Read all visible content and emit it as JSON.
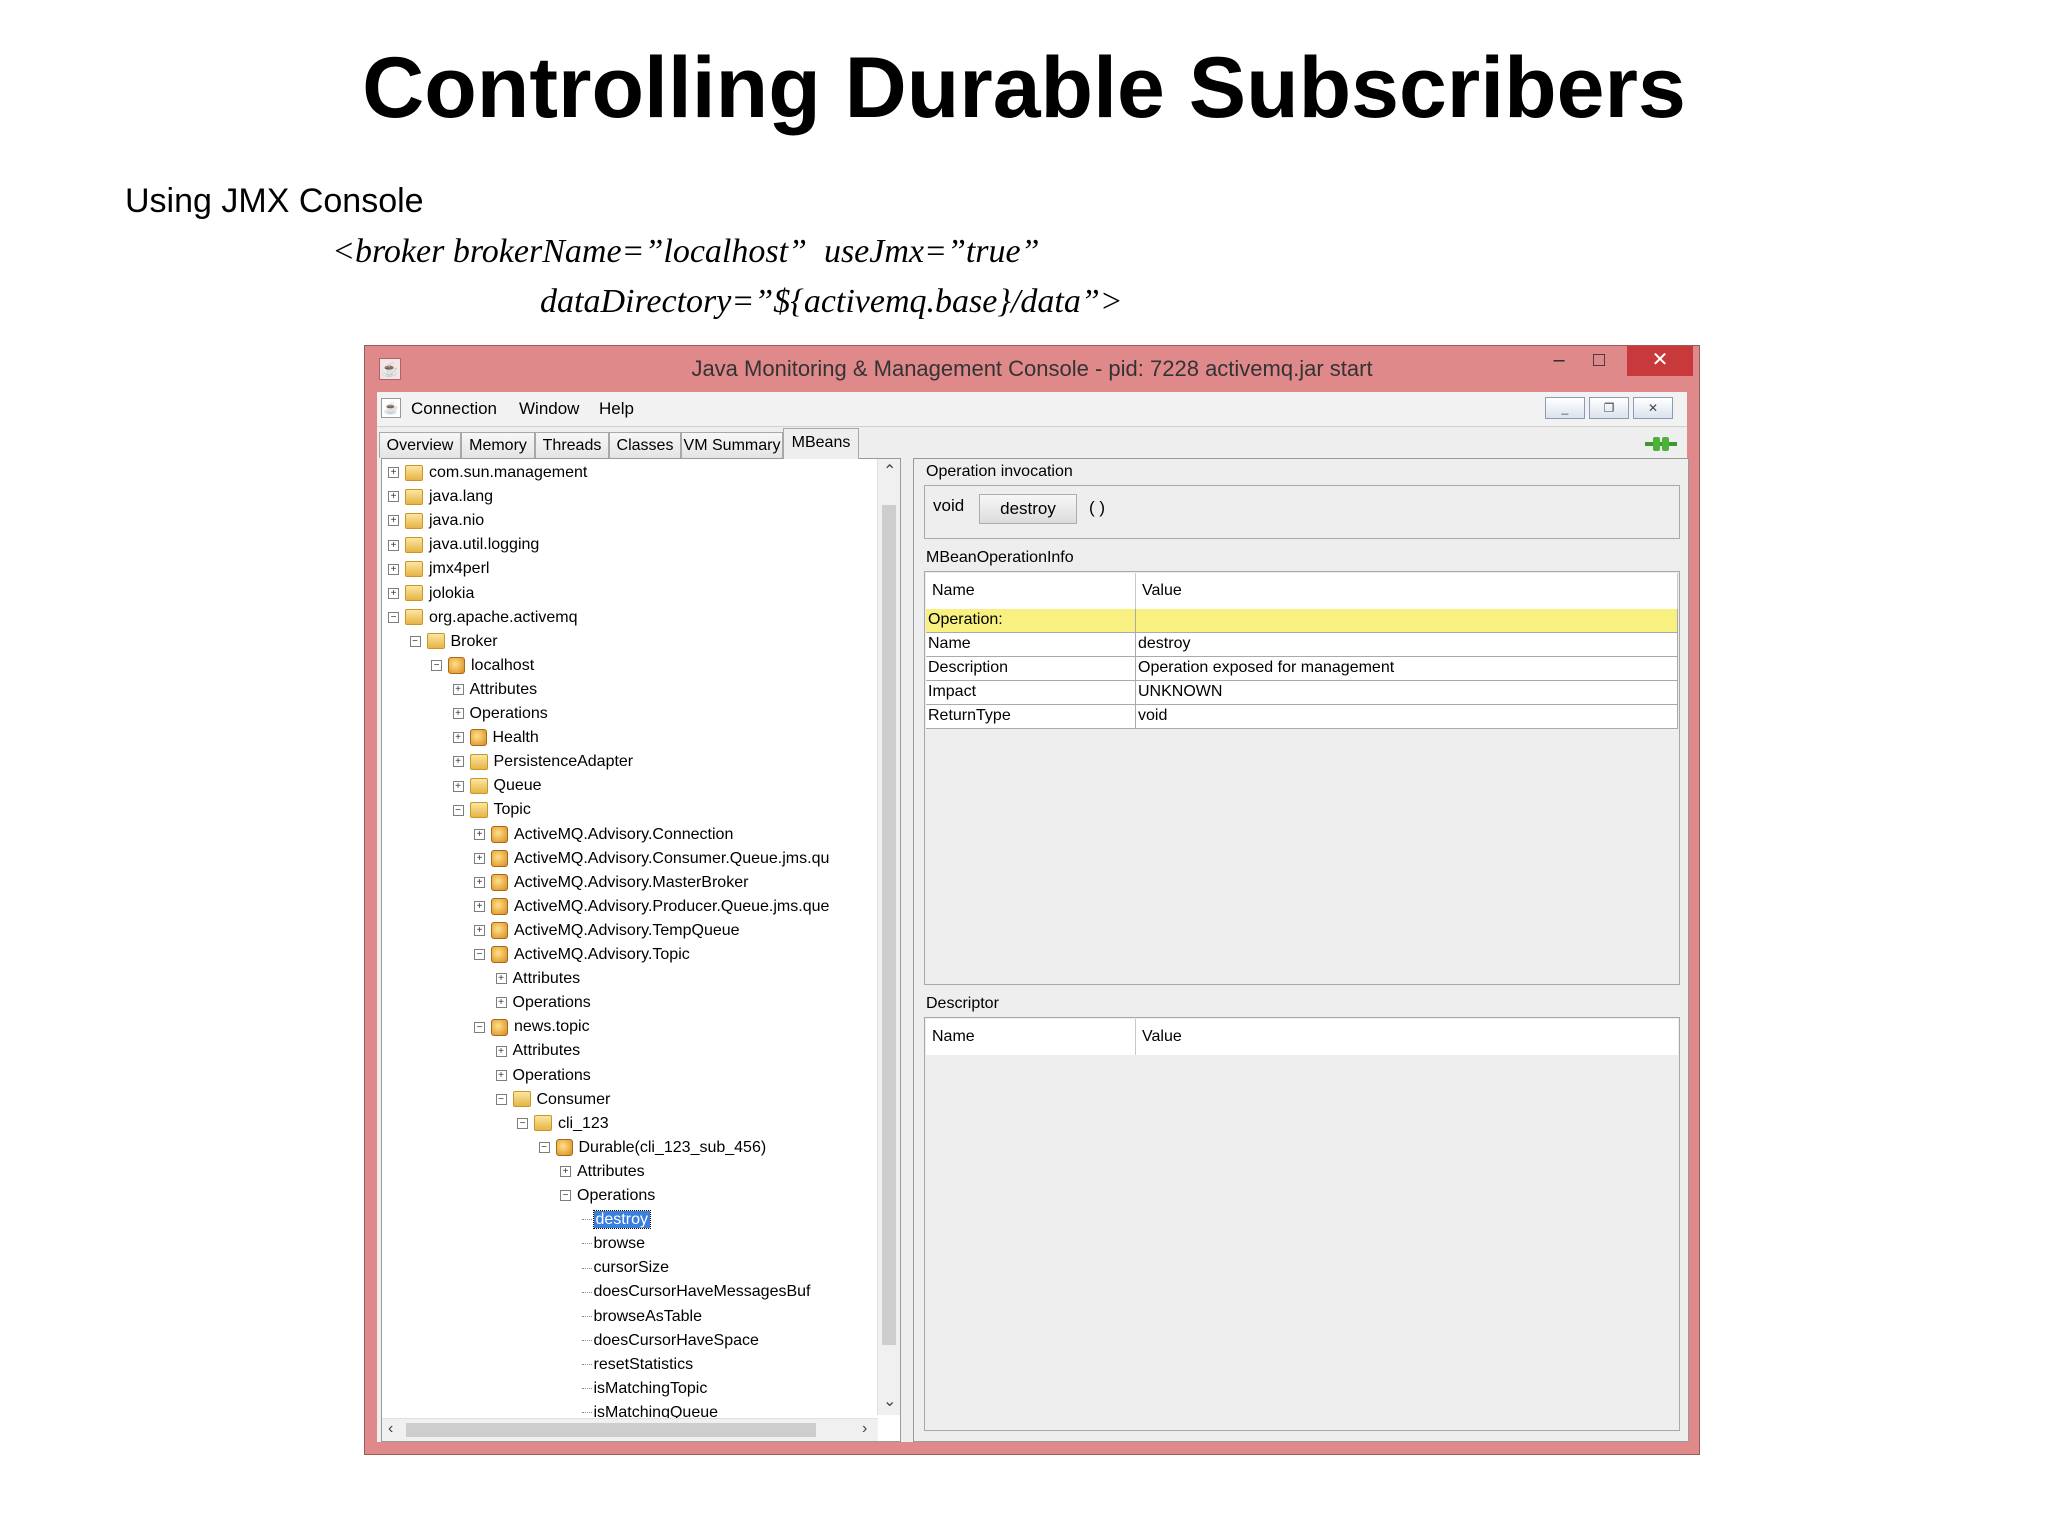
{
  "slide": {
    "title": "Controlling Durable Subscribers",
    "subtitle": "Using JMX Console",
    "code_line1": "<broker brokerName=”localhost”  useJmx=”true”",
    "code_line2": "dataDirectory=”${activemq.base}/data”>"
  },
  "window": {
    "title": "Java Monitoring & Management Console - pid: 7228 activemq.jar start",
    "controls": {
      "minimize": "–",
      "maximize": "□",
      "close": "✕"
    },
    "inner_controls": {
      "minimize": "_",
      "restore": "❐",
      "close": "✕"
    }
  },
  "menu": {
    "items": [
      "Connection",
      "Window",
      "Help"
    ]
  },
  "tabs": {
    "items": [
      "Overview",
      "Memory",
      "Threads",
      "Classes",
      "VM Summary",
      "MBeans"
    ],
    "active": "MBeans"
  },
  "tree": {
    "nodes": [
      {
        "label": "com.sun.management",
        "toggle": "+",
        "icon": "folder"
      },
      {
        "label": "java.lang",
        "toggle": "+",
        "icon": "folder"
      },
      {
        "label": "java.nio",
        "toggle": "+",
        "icon": "folder"
      },
      {
        "label": "java.util.logging",
        "toggle": "+",
        "icon": "folder"
      },
      {
        "label": "jmx4perl",
        "toggle": "+",
        "icon": "folder"
      },
      {
        "label": "jolokia",
        "toggle": "+",
        "icon": "folder"
      },
      {
        "label": "org.apache.activemq",
        "toggle": "−",
        "icon": "folder"
      },
      {
        "label": "Broker",
        "toggle": "−",
        "icon": "folder"
      },
      {
        "label": "localhost",
        "toggle": "−",
        "icon": "bean"
      },
      {
        "label": "Attributes",
        "toggle": "+",
        "icon": "none"
      },
      {
        "label": "Operations",
        "toggle": "+",
        "icon": "none"
      },
      {
        "label": "Health",
        "toggle": "+",
        "icon": "bean"
      },
      {
        "label": "PersistenceAdapter",
        "toggle": "+",
        "icon": "folder"
      },
      {
        "label": "Queue",
        "toggle": "+",
        "icon": "folder"
      },
      {
        "label": "Topic",
        "toggle": "−",
        "icon": "folder"
      },
      {
        "label": "ActiveMQ.Advisory.Connection",
        "toggle": "+",
        "icon": "bean"
      },
      {
        "label": "ActiveMQ.Advisory.Consumer.Queue.jms.qu",
        "toggle": "+",
        "icon": "bean"
      },
      {
        "label": "ActiveMQ.Advisory.MasterBroker",
        "toggle": "+",
        "icon": "bean"
      },
      {
        "label": "ActiveMQ.Advisory.Producer.Queue.jms.que",
        "toggle": "+",
        "icon": "bean"
      },
      {
        "label": "ActiveMQ.Advisory.TempQueue",
        "toggle": "+",
        "icon": "bean"
      },
      {
        "label": "ActiveMQ.Advisory.Topic",
        "toggle": "−",
        "icon": "bean"
      },
      {
        "label": "Attributes",
        "toggle": "+",
        "icon": "none"
      },
      {
        "label": "Operations",
        "toggle": "+",
        "icon": "none"
      },
      {
        "label": "news.topic",
        "toggle": "−",
        "icon": "bean"
      },
      {
        "label": "Attributes",
        "toggle": "+",
        "icon": "none"
      },
      {
        "label": "Operations",
        "toggle": "+",
        "icon": "none"
      },
      {
        "label": "Consumer",
        "toggle": "−",
        "icon": "folder"
      },
      {
        "label": "cli_123",
        "toggle": "−",
        "icon": "folder"
      },
      {
        "label": "Durable(cli_123_sub_456)",
        "toggle": "−",
        "icon": "bean"
      },
      {
        "label": "Attributes",
        "toggle": "+",
        "icon": "none"
      },
      {
        "label": "Operations",
        "toggle": "−",
        "icon": "none"
      },
      {
        "label": "destroy",
        "toggle": "",
        "icon": "leaf",
        "selected": true
      },
      {
        "label": "browse",
        "toggle": "",
        "icon": "leaf"
      },
      {
        "label": "cursorSize",
        "toggle": "",
        "icon": "leaf"
      },
      {
        "label": "doesCursorHaveMessagesBuf",
        "toggle": "",
        "icon": "leaf"
      },
      {
        "label": "browseAsTable",
        "toggle": "",
        "icon": "leaf"
      },
      {
        "label": "doesCursorHaveSpace",
        "toggle": "",
        "icon": "leaf"
      },
      {
        "label": "resetStatistics",
        "toggle": "",
        "icon": "leaf"
      },
      {
        "label": "isMatchingTopic",
        "toggle": "",
        "icon": "leaf"
      },
      {
        "label": "isMatchingQueue",
        "toggle": "",
        "icon": "leaf"
      }
    ]
  },
  "invocation": {
    "label": "Operation invocation",
    "return_type": "void",
    "button": "destroy",
    "params": "( )"
  },
  "info": {
    "label": "MBeanOperationInfo",
    "headers": [
      "Name",
      "Value"
    ],
    "rows": [
      {
        "name": "Operation:",
        "value": ""
      },
      {
        "name": "Name",
        "value": "destroy"
      },
      {
        "name": "Description",
        "value": "Operation exposed for management"
      },
      {
        "name": "Impact",
        "value": "UNKNOWN"
      },
      {
        "name": "ReturnType",
        "value": "void"
      }
    ],
    "highlight_color": "#f8f080"
  },
  "descriptor": {
    "label": "Descriptor",
    "headers": [
      "Name",
      "Value"
    ]
  },
  "colors": {
    "window_frame": "#e0898b",
    "close_button": "#c7393b",
    "selection": "#3a7fdc"
  }
}
